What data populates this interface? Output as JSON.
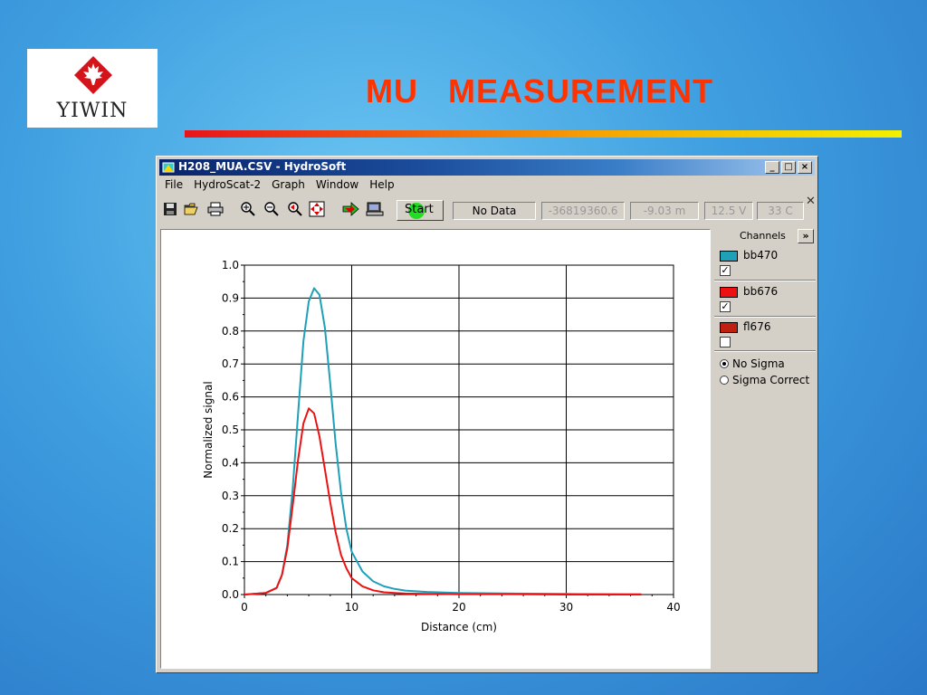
{
  "slide": {
    "title": "MU   MEASUREMENT",
    "logo_text": "YIWIN"
  },
  "window": {
    "title": "H208_MUA.CSV - HydroSoft",
    "controls": [
      "minimize",
      "maximize",
      "close"
    ],
    "menu": [
      "File",
      "HydroScat-2",
      "Graph",
      "Window",
      "Help"
    ]
  },
  "toolbar": {
    "icons": [
      "save-icon",
      "open-icon",
      "print-icon",
      "zoom-in-icon",
      "zoom-out-icon",
      "zoom-back-icon",
      "fit-icon",
      "arrow-right-icon",
      "instrument-icon"
    ],
    "start_label": "Start",
    "status": [
      "No Data",
      "-36819360.6",
      "-9.03 m",
      "12.5 V",
      "33 C"
    ]
  },
  "sidebar": {
    "header": "Channels",
    "expand_label": "»",
    "channels": [
      {
        "name": "bb470",
        "color": "#1ea0b8",
        "checked": true
      },
      {
        "name": "bb676",
        "color": "#ee1111",
        "checked": true
      },
      {
        "name": "fl676",
        "color": "#c02010",
        "checked": false
      }
    ],
    "sigma_options": [
      {
        "label": "No Sigma",
        "selected": true
      },
      {
        "label": "Sigma Correct",
        "selected": false
      }
    ]
  },
  "chart_data": {
    "type": "line",
    "xlabel": "Distance (cm)",
    "ylabel": "Normalized signal",
    "xlim": [
      0,
      40
    ],
    "ylim": [
      0,
      1.0
    ],
    "xticks": [
      "0",
      "10",
      "20",
      "30",
      "40"
    ],
    "yticks": [
      "0.0",
      "0.1",
      "0.2",
      "0.3",
      "0.4",
      "0.5",
      "0.6",
      "0.7",
      "0.8",
      "0.9",
      "1.0"
    ],
    "grid": true,
    "series": [
      {
        "name": "bb470",
        "color": "#1ea0b8",
        "x": [
          0,
          2,
          3,
          3.5,
          4,
          4.5,
          5,
          5.5,
          6,
          6.5,
          7,
          7.5,
          8,
          8.5,
          9,
          9.5,
          10,
          11,
          12,
          13,
          14,
          15,
          17,
          20,
          25,
          30,
          37
        ],
        "y": [
          0.0,
          0.005,
          0.02,
          0.06,
          0.15,
          0.32,
          0.55,
          0.77,
          0.89,
          0.93,
          0.91,
          0.81,
          0.64,
          0.46,
          0.31,
          0.2,
          0.13,
          0.07,
          0.04,
          0.025,
          0.017,
          0.012,
          0.008,
          0.005,
          0.003,
          0.002,
          0.001
        ]
      },
      {
        "name": "bb676",
        "color": "#ee1111",
        "x": [
          0,
          2,
          3,
          3.5,
          4,
          4.5,
          5,
          5.5,
          6,
          6.5,
          7,
          7.5,
          8,
          8.5,
          9,
          9.5,
          10,
          11,
          12,
          13,
          14,
          15,
          17,
          20,
          25,
          30,
          37
        ],
        "y": [
          0.0,
          0.005,
          0.02,
          0.06,
          0.14,
          0.27,
          0.41,
          0.52,
          0.565,
          0.55,
          0.48,
          0.38,
          0.28,
          0.19,
          0.12,
          0.08,
          0.05,
          0.025,
          0.013,
          0.007,
          0.005,
          0.003,
          0.002,
          0.001,
          0.001,
          0.0,
          0.0
        ]
      }
    ]
  }
}
